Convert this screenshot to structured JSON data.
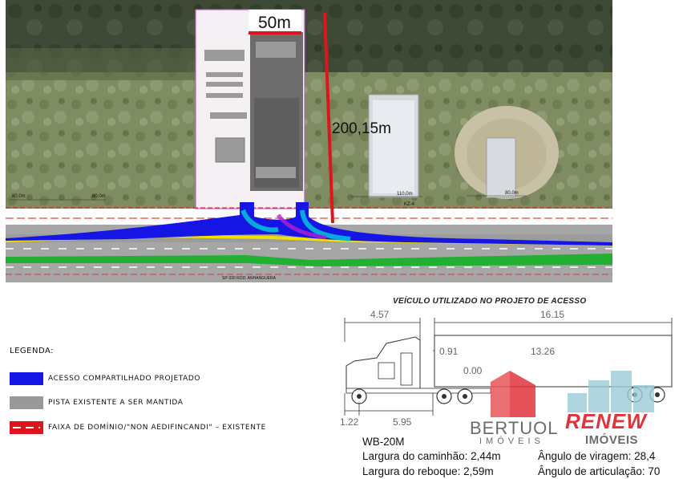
{
  "map": {
    "dimension_width": "50m",
    "dimension_depth": "200,15m",
    "labels": {
      "left_80": "80,0m",
      "left_80b": "80,0m",
      "mid_110": "110,0m",
      "right_80": "80,0m",
      "road_name": "SP-330 ROD. ANHANGUERA",
      "kz": "KZ-4"
    },
    "colors": {
      "access": "#1010e0",
      "existing": "#9a9a9a",
      "limit": "#e0141e",
      "median": "#22b033",
      "shoulder": "#f0e000"
    }
  },
  "legend": {
    "title": "LEGENDA:",
    "items": [
      {
        "label": "ACESSO COMPARTILHADO PROJETADO",
        "color": "#1515e6"
      },
      {
        "label": "PISTA EXISTENTE A SER MANTIDA",
        "color": "#999999"
      },
      {
        "label": "FAIXA DE DOMÍNIO/\"NON AEDIFINCANDI\" – EXISTENTE",
        "color": "#e0141e"
      }
    ]
  },
  "vehicle": {
    "title": "VEÍCULO UTILIZADO NO PROJETO DE ACESSO",
    "dims": {
      "cab_length": "4.57",
      "trailer_length": "16.15",
      "d_091": "0.91",
      "d_1326": "13.26",
      "d_000": "0.00",
      "front_overhang": "1.22",
      "wheelbase": "5.95"
    },
    "model": "WB-20M",
    "specs": [
      "Largura do caminhão: 2,44m",
      "Largura do reboque: 2,59m",
      "Ângulo de viragem: 28,4",
      "Ângulo de articulação: 70"
    ]
  },
  "logos": {
    "bertuol_name": "BERTUOL",
    "bertuol_sub": "IMÓVEIS",
    "renew_name": "RENEW",
    "renew_sub": "IMÓVEIS"
  }
}
